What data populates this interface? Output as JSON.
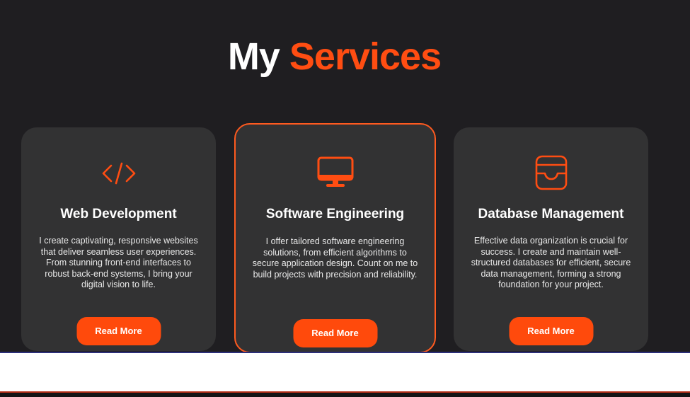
{
  "section": {
    "heading_white": "My",
    "heading_accent": "Services"
  },
  "colors": {
    "accent": "#ff4d12",
    "background": "#1f1e21",
    "card": "#323233"
  },
  "cards": [
    {
      "icon": "code-icon",
      "title": "Web Development",
      "description": "I create captivating, responsive websites that deliver seamless user experiences. From stunning front-end interfaces to robust back-end systems, I bring your digital vision to life.",
      "button_label": "Read More"
    },
    {
      "icon": "monitor-icon",
      "title": "Software Engineering",
      "description": "I offer tailored software engineering solutions, from efficient algorithms to secure application design. Count on me to build projects with precision and reliability.",
      "button_label": "Read More",
      "highlighted": true
    },
    {
      "icon": "inbox-tray-icon",
      "title": "Database Management",
      "description": "Effective data organization is crucial for success. I create and maintain well-structured databases for efficient, secure data management, forming a strong foundation for your project.",
      "button_label": "Read More"
    }
  ]
}
